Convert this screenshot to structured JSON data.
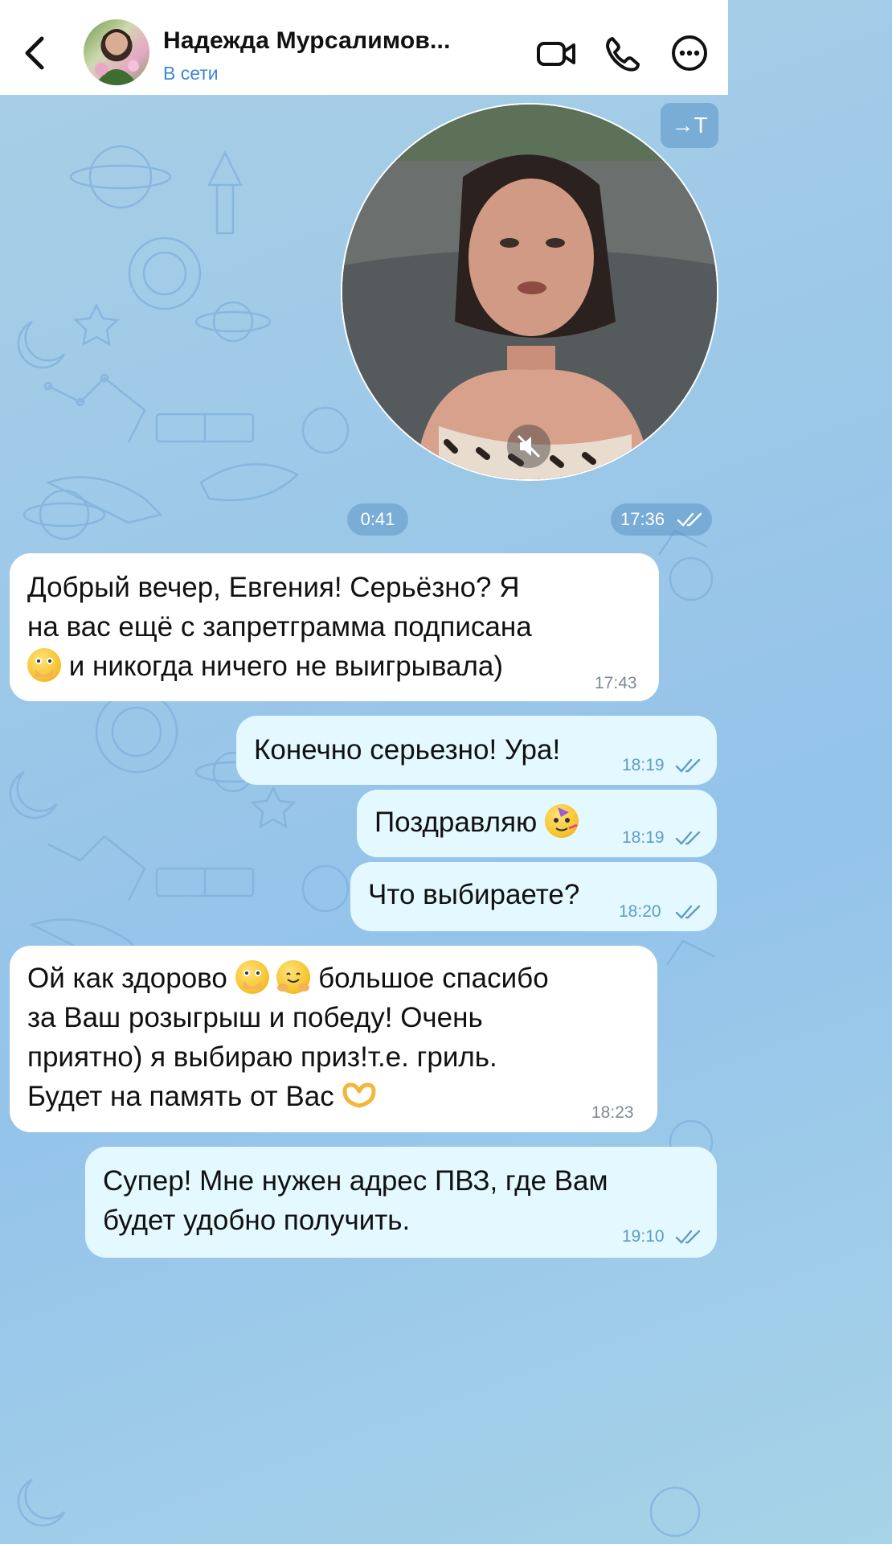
{
  "header": {
    "contact_name": "Надежда Мурсалимов...",
    "status": "В сети"
  },
  "video_message": {
    "translate_label": "→T",
    "duration": "0:41",
    "time": "17:36"
  },
  "messages": [
    {
      "direction": "in",
      "lines": [
        "Добрый вечер, Евгения! Серьёзно?  Я",
        "на вас ещё с запретграмма подписана",
        " и никогда ничего не выигрывала)"
      ],
      "time": "17:43"
    },
    {
      "direction": "out",
      "text": "Конечно серьезно! Ура!",
      "time": "18:19"
    },
    {
      "direction": "out",
      "text": "Поздравляю",
      "time": "18:19"
    },
    {
      "direction": "out",
      "text": "Что выбираете?",
      "time": "18:20"
    },
    {
      "direction": "in",
      "lines": [
        "Ой как здорово",
        "большое спасибо",
        "за Ваш розыгрыш и победу! Очень",
        "приятно) я выбираю приз!т.е. гриль.",
        "Будет на память от Вас"
      ],
      "time": "18:23"
    },
    {
      "direction": "out",
      "lines": [
        "Супер! Мне нужен адрес ПВЗ, где Вам",
        "будет удобно получить."
      ],
      "time": "19:10"
    }
  ],
  "icons": {
    "back": "chevron-left-icon",
    "video_call": "video-camera-icon",
    "voice_call": "phone-icon",
    "more": "more-icon",
    "muted": "muted-speaker-icon",
    "read": "double-check-icon"
  }
}
